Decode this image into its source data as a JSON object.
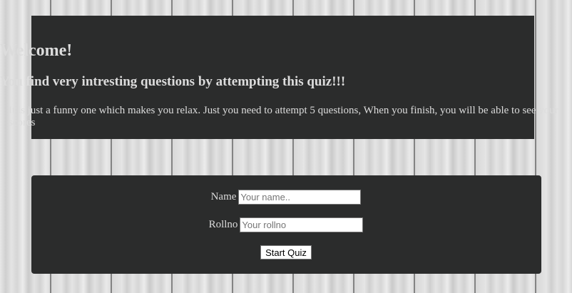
{
  "welcome": {
    "title": "Welcome!",
    "subtitle": "You find very intresting questions by attempting this quiz!!!",
    "description": "It is just a funny one which makes you relax. Just you need to attempt 5 questions, When you finish, you will be able to see your scores"
  },
  "form": {
    "name_label": "Name",
    "name_placeholder": "Your name..",
    "rollno_label": "Rollno",
    "rollno_placeholder": "Your rollno",
    "start_button": "Start Quiz"
  },
  "colors": {
    "panel_background": "#2b2c2c",
    "panel_text": "#dcdcdc"
  }
}
